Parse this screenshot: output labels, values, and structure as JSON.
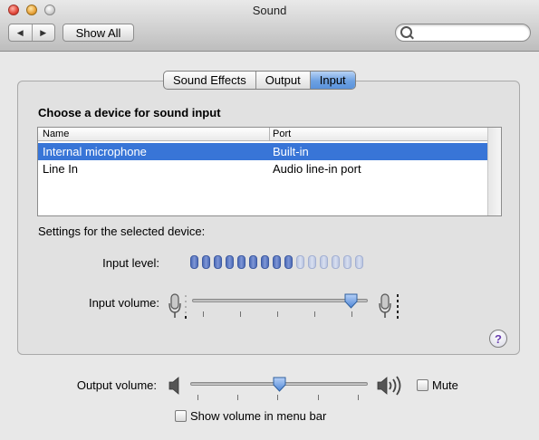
{
  "window": {
    "title": "Sound"
  },
  "toolbar": {
    "back_glyph": "◀",
    "forward_glyph": "▶",
    "show_all_label": "Show All",
    "search": {
      "value": "",
      "placeholder": ""
    }
  },
  "tabs": [
    {
      "label": "Sound Effects",
      "selected": false
    },
    {
      "label": "Output",
      "selected": false
    },
    {
      "label": "Input",
      "selected": true
    }
  ],
  "input_pane": {
    "heading": "Choose a device for sound input",
    "columns": {
      "name": "Name",
      "port": "Port"
    },
    "devices": [
      {
        "name": "Internal microphone",
        "port": "Built-in",
        "selected": true
      },
      {
        "name": "Line In",
        "port": "Audio line-in port",
        "selected": false
      }
    ],
    "settings_label": "Settings for the selected device:",
    "input_level_label": "Input level:",
    "input_level": {
      "segments_total": 15,
      "segments_lit": 9
    },
    "input_volume_label": "Input volume:",
    "input_volume_fraction": 0.94,
    "help_glyph": "?"
  },
  "output": {
    "output_volume_label": "Output volume:",
    "output_volume_fraction": 0.5,
    "mute_label": "Mute",
    "mute_checked": false,
    "show_volume_label": "Show volume in menu bar",
    "show_volume_checked": false
  },
  "colors": {
    "selection": "#3875d7",
    "tab_selected": "#6da1e2",
    "meter_on": "#5b78c4",
    "meter_off": "#c8d1ea"
  },
  "icons": {
    "mic_low": "microphone-low-icon",
    "mic_high": "microphone-high-icon",
    "speaker_low": "speaker-low-icon",
    "speaker_high": "speaker-high-icon",
    "search": "search-icon"
  }
}
